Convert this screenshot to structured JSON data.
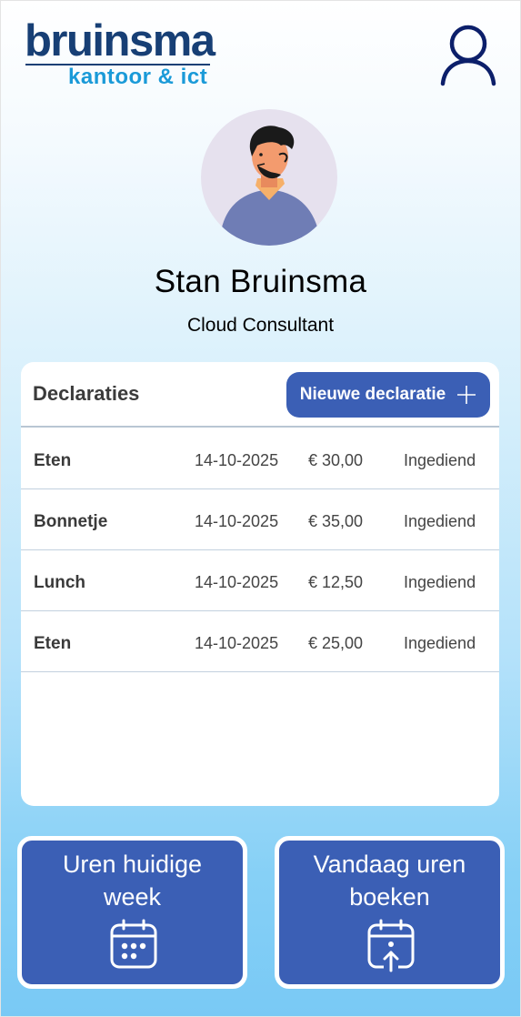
{
  "brand": {
    "name": "bruinsma",
    "tagline": "kantoor & ict"
  },
  "header": {
    "user_icon": "user-icon"
  },
  "profile": {
    "name": "Stan Bruinsma",
    "role": "Cloud Consultant",
    "avatar_icon": "person-avatar"
  },
  "declarations": {
    "title": "Declaraties",
    "new_button_label": "Nieuwe declaratie",
    "new_button_icon": "plus-icon",
    "rows": [
      {
        "description": "Eten",
        "date": "14-10-2025",
        "amount": "€ 30,00",
        "status": "Ingediend"
      },
      {
        "description": "Bonnetje",
        "date": "14-10-2025",
        "amount": "€ 35,00",
        "status": "Ingediend"
      },
      {
        "description": "Lunch",
        "date": "14-10-2025",
        "amount": "€ 12,50",
        "status": "Ingediend"
      },
      {
        "description": "Eten",
        "date": "14-10-2025",
        "amount": "€ 25,00",
        "status": "Ingediend"
      }
    ]
  },
  "tiles": {
    "week": {
      "label_line1": "Uren huidige",
      "label_line2": "week",
      "icon": "calendar-icon"
    },
    "today": {
      "label_line1": "Vandaag uren",
      "label_line2": "boeken",
      "icon": "calendar-upload-icon"
    }
  },
  "colors": {
    "brand_dark": "#173f75",
    "brand_light": "#1a9ad8",
    "accent": "#3b5fb5",
    "background_top": "#ffffff",
    "background_bottom": "#79c9f5"
  }
}
